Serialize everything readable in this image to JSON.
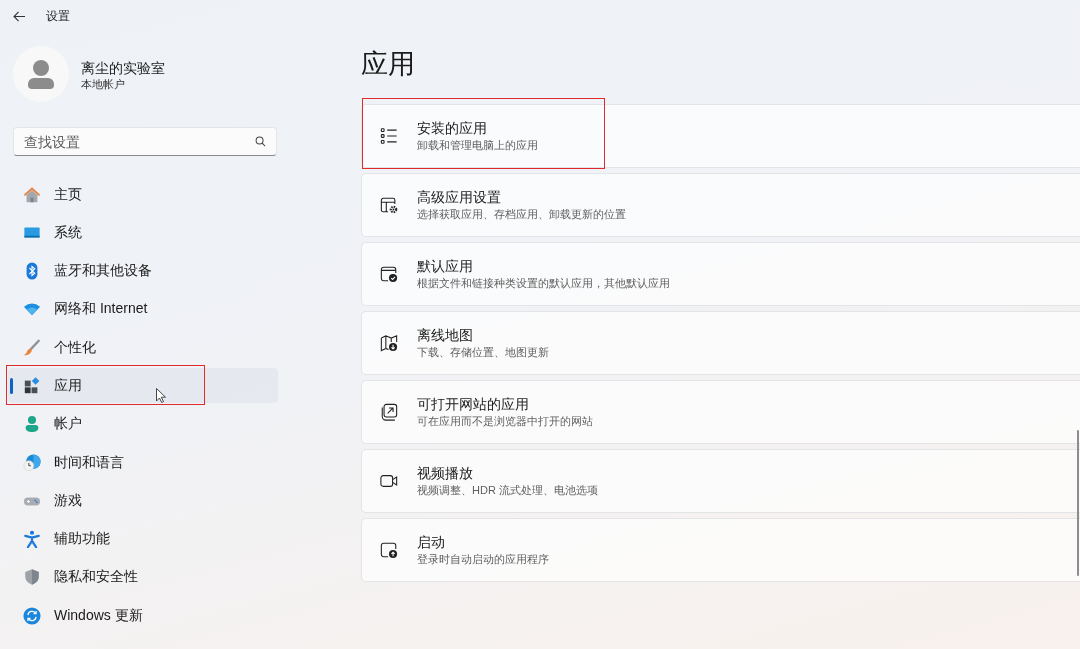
{
  "window": {
    "title": "设置"
  },
  "account": {
    "name": "离尘的实验室",
    "type": "本地帐户"
  },
  "search": {
    "placeholder": "查找设置"
  },
  "sidebar": {
    "items": [
      {
        "label": "主页",
        "selected": false,
        "highlighted": false,
        "cursor": false
      },
      {
        "label": "系统",
        "selected": false,
        "highlighted": false,
        "cursor": false
      },
      {
        "label": "蓝牙和其他设备",
        "selected": false,
        "highlighted": false,
        "cursor": false
      },
      {
        "label": "网络和 Internet",
        "selected": false,
        "highlighted": false,
        "cursor": false
      },
      {
        "label": "个性化",
        "selected": false,
        "highlighted": false,
        "cursor": false
      },
      {
        "label": "应用",
        "selected": true,
        "highlighted": true,
        "cursor": true
      },
      {
        "label": "帐户",
        "selected": false,
        "highlighted": false,
        "cursor": false
      },
      {
        "label": "时间和语言",
        "selected": false,
        "highlighted": false,
        "cursor": false
      },
      {
        "label": "游戏",
        "selected": false,
        "highlighted": false,
        "cursor": false
      },
      {
        "label": "辅助功能",
        "selected": false,
        "highlighted": false,
        "cursor": false
      },
      {
        "label": "隐私和安全性",
        "selected": false,
        "highlighted": false,
        "cursor": false
      },
      {
        "label": "Windows 更新",
        "selected": false,
        "highlighted": false,
        "cursor": false
      }
    ]
  },
  "page": {
    "title": "应用"
  },
  "cards": [
    {
      "title": "安装的应用",
      "subtitle": "卸载和管理电脑上的应用",
      "highlighted": true
    },
    {
      "title": "高级应用设置",
      "subtitle": "选择获取应用、存档应用、卸载更新的位置",
      "highlighted": false
    },
    {
      "title": "默认应用",
      "subtitle": "根据文件和链接种类设置的默认应用，其他默认应用",
      "highlighted": false
    },
    {
      "title": "离线地图",
      "subtitle": "下载、存储位置、地图更新",
      "highlighted": false
    },
    {
      "title": "可打开网站的应用",
      "subtitle": "可在应用而不是浏览器中打开的网站",
      "highlighted": false
    },
    {
      "title": "视频播放",
      "subtitle": "视频调整、HDR 流式处理、电池选项",
      "highlighted": false
    },
    {
      "title": "启动",
      "subtitle": "登录时自动启动的应用程序",
      "highlighted": false
    }
  ]
}
